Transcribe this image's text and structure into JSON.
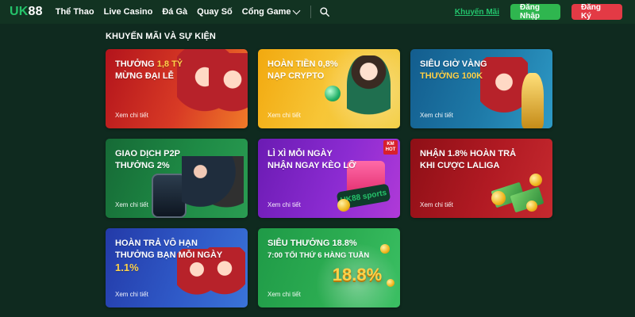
{
  "header": {
    "logo": {
      "part1": "UK",
      "part2": "88"
    },
    "nav": [
      {
        "label": "Thể Thao"
      },
      {
        "label": "Live Casino"
      },
      {
        "label": "Đá Gà"
      },
      {
        "label": "Quay Số"
      },
      {
        "label": "Cổng Game"
      }
    ],
    "promo_link": "Khuyến Mãi",
    "login_label": "Đăng Nhập",
    "register_label": "Đăng Ký",
    "icons": {
      "search": "search-icon",
      "dropdown": "chevron-down-icon"
    }
  },
  "section": {
    "title": "KHUYẾN MÃI VÀ SỰ KIỆN"
  },
  "promotions": [
    {
      "title_line1_prefix": "THƯỞNG ",
      "title_line1_highlight": "1,8 TỶ",
      "title_line2": "MỪNG ĐẠI LỄ",
      "cta": "Xem chi tiết",
      "accent": "#d62b2b"
    },
    {
      "title_line1": "HOÀN TIỀN 0,8%",
      "title_line2": "NẠP CRYPTO",
      "cta": "Xem chi tiết",
      "accent": "#f3b51b"
    },
    {
      "title_line1": "SIÊU GIỜ VÀNG",
      "title_line2": "THƯỞNG 100K",
      "cta": "Xem chi tiết",
      "accent": "#2c8bb8"
    },
    {
      "title_line1": "GIAO DỊCH P2P",
      "title_line2": "THƯỞNG 2%",
      "cta": "Xem chi tiết",
      "accent": "#1f8a3f"
    },
    {
      "title_line1": "LÌ XÌ MỖI NGÀY",
      "title_line2": "NHẬN NGAY KÈO LỠ",
      "cta": "Xem chi tiết",
      "accent": "#8b2bd1",
      "badge": {
        "line1": "KM",
        "line2": "HOT"
      },
      "logo_text": "UK88 sports"
    },
    {
      "title_line1": "NHẬN 1.8% HOÀN TRẢ",
      "title_line2": "KHI CƯỢC LALIGA",
      "cta": "Xem chi tiết",
      "accent": "#a3151d"
    },
    {
      "title_line1": "HOÀN TRẢ VÔ HẠN",
      "title_line2": "THƯỞNG BẠN MỖI NGÀY",
      "title_line3": "1.1%",
      "cta": "Xem chi tiết",
      "accent": "#2a3fb6"
    },
    {
      "title_line1": "SIÊU THƯỞNG 18.8%",
      "title_line2": "7:00 TỐI THỨ 6 HÀNG TUẦN",
      "cta": "Xem chi tiết",
      "accent": "#2cad52",
      "decor_text": "18.8%"
    }
  ]
}
